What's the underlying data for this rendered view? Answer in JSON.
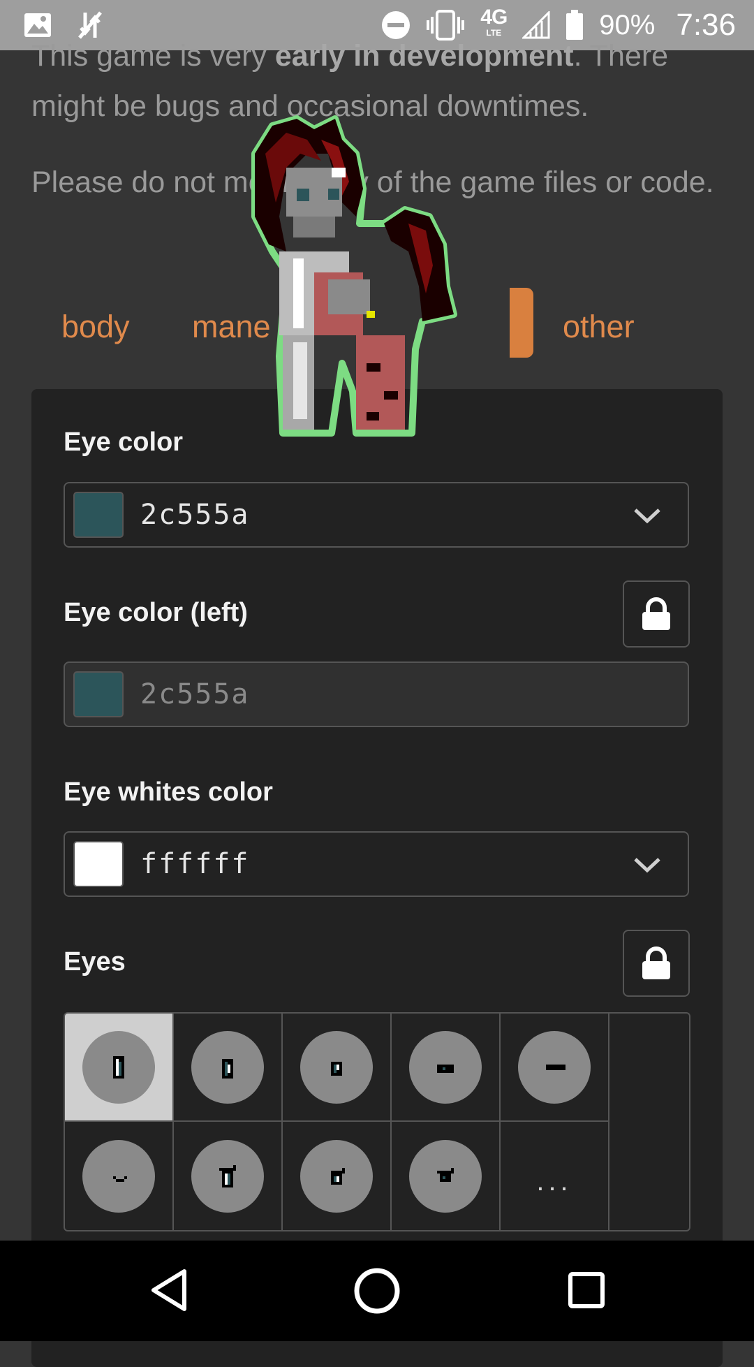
{
  "status_bar": {
    "battery": "90%",
    "time": "7:36",
    "network": "4G",
    "network_sub": "LTE",
    "icons": [
      "image-icon",
      "data-off-icon",
      "do-not-disturb-icon",
      "vibrate-icon",
      "signal-icon",
      "battery-icon"
    ]
  },
  "intro": {
    "p1_pre": "This game is very ",
    "p1_bold": "early in development",
    "p1_post": ". There might be bugs and occasional downtimes.",
    "p2": "Please do not modify any of the game files or code."
  },
  "tabs": [
    "body",
    "mane",
    "other"
  ],
  "fields": {
    "eye_color": {
      "label": "Eye color",
      "value": "2c555a",
      "swatch": "#2c555a"
    },
    "eye_color_left": {
      "label": "Eye color (left)",
      "value": "2c555a",
      "swatch": "#2c555a"
    },
    "eye_whites": {
      "label": "Eye whites color",
      "value": "ffffff",
      "swatch": "#ffffff"
    },
    "eyes": {
      "label": "Eyes",
      "more_label": "..."
    }
  },
  "colors": {
    "accent": "#e08a4c",
    "panel": "#222222",
    "background": "#353535"
  }
}
